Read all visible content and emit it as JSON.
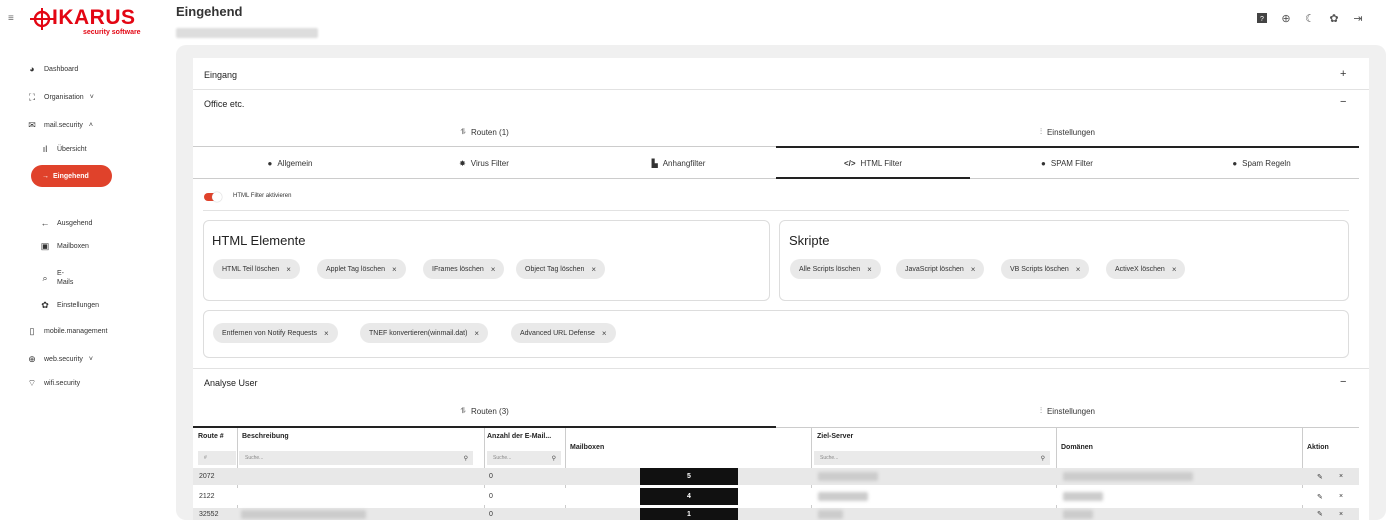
{
  "app": {
    "brand": "IKARUS",
    "brand_sub": "security software",
    "page_title": "Eingehend"
  },
  "sidebar": {
    "items": [
      {
        "label": "Dashboard",
        "icon": "dashboard-icon"
      },
      {
        "label": "Organisation",
        "icon": "org-icon",
        "chevron": "˅"
      },
      {
        "label": "mail.security",
        "icon": "mail-icon",
        "chevron": "˄"
      },
      {
        "label": "Übersicht",
        "icon": "bar-chart-icon"
      },
      {
        "label": "Eingehend",
        "icon": "arrow-right-icon"
      },
      {
        "label": "Ausgehend",
        "icon": "arrow-left-icon"
      },
      {
        "label": "Mailboxen",
        "icon": "mailboxes-icon"
      },
      {
        "label_top": "E-",
        "label_bottom": "Mails",
        "icon": "search-icon"
      },
      {
        "label": "Einstellungen",
        "icon": "gear-icon"
      },
      {
        "label": "mobile.management",
        "icon": "mobile-icon"
      },
      {
        "label": "web.security",
        "icon": "globe-icon",
        "chevron": "˅"
      },
      {
        "label": "wifi.security",
        "icon": "wifi-icon"
      }
    ]
  },
  "sections": {
    "eingang": {
      "title": "Eingang",
      "sign": "+"
    },
    "office": {
      "title": "Office etc.",
      "sign": "−"
    },
    "analyse": {
      "title": "Analyse User",
      "sign": "−"
    }
  },
  "office_tabs": [
    {
      "label": "Routen (1)"
    },
    {
      "label": "Einstellungen"
    }
  ],
  "filter_tabs": [
    {
      "label": "Allgemein"
    },
    {
      "label": "Virus Filter"
    },
    {
      "label": "Anhangfilter"
    },
    {
      "label": "HTML Filter"
    },
    {
      "label": "SPAM Filter"
    },
    {
      "label": "Spam Regeln"
    }
  ],
  "toggle": {
    "label": "HTML Filter aktivieren",
    "on": true
  },
  "html_elements": {
    "title": "HTML Elemente",
    "chips": [
      "HTML Teil löschen",
      "Applet Tag löschen",
      "IFrames löschen",
      "Object Tag löschen"
    ]
  },
  "scripts": {
    "title": "Skripte",
    "chips": [
      "Alle Scripts löschen",
      "JavaScript löschen",
      "VB Scripts löschen",
      "ActiveX löschen"
    ]
  },
  "misc_chips": [
    "Entfernen von Notify Requests",
    "TNEF konvertieren(winmail.dat)",
    "Advanced URL Defense"
  ],
  "analyse_tabs": [
    {
      "label": "Routen (3)"
    },
    {
      "label": "Einstellungen"
    }
  ],
  "table": {
    "headers": {
      "route": "Route #",
      "beschreibung": "Beschreibung",
      "anzahl": "Anzahl der E-Mail...",
      "mailboxen": "Mailboxen",
      "zielserver": "Ziel-Server",
      "domaenen": "Domänen",
      "aktion": "Aktion"
    },
    "search": {
      "route": "#",
      "beschreibung": "Suche...",
      "anzahl": "Suche...",
      "zielserver": "Suche..."
    },
    "rows": [
      {
        "route": "2072",
        "anzahl": "0",
        "mailboxen": "5"
      },
      {
        "route": "2122",
        "anzahl": "0",
        "mailboxen": "4"
      },
      {
        "route": "32552",
        "anzahl": "0",
        "mailboxen": "1"
      }
    ],
    "row_actions": {
      "edit": "✎",
      "delete": "×"
    }
  },
  "colors": {
    "accent": "#e0422b",
    "brand": "#e30613"
  }
}
